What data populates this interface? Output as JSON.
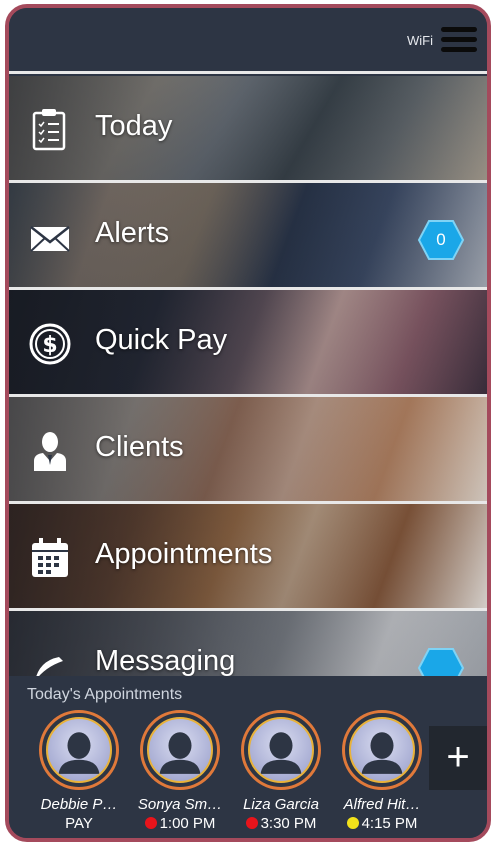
{
  "status": {
    "wifi_label": "WiFi"
  },
  "menu": {
    "items": [
      {
        "label": "Today",
        "icon": "clipboard-icon"
      },
      {
        "label": "Alerts",
        "icon": "envelope-icon",
        "badge": "0"
      },
      {
        "label": "Quick Pay",
        "icon": "dollar-icon"
      },
      {
        "label": "Clients",
        "icon": "person-icon"
      },
      {
        "label": "Appointments",
        "icon": "calendar-icon"
      },
      {
        "label": "Messaging",
        "icon": "chat-icon"
      }
    ]
  },
  "appointments": {
    "title": "Today's Appointments",
    "items": [
      {
        "name": "Debbie P…",
        "status": "PAY",
        "dot": ""
      },
      {
        "name": "Sonya Sm…",
        "status": "1:00 PM",
        "dot": "#e8141b"
      },
      {
        "name": "Liza Garcia",
        "status": "3:30 PM",
        "dot": "#e8141b"
      },
      {
        "name": "Alfred Hit…",
        "status": "4:15 PM",
        "dot": "#f2e21a"
      }
    ],
    "add_label": "+"
  },
  "colors": {
    "badge": "#1aa7e8",
    "frame": "#a44a5c",
    "panel": "#2d3544"
  }
}
